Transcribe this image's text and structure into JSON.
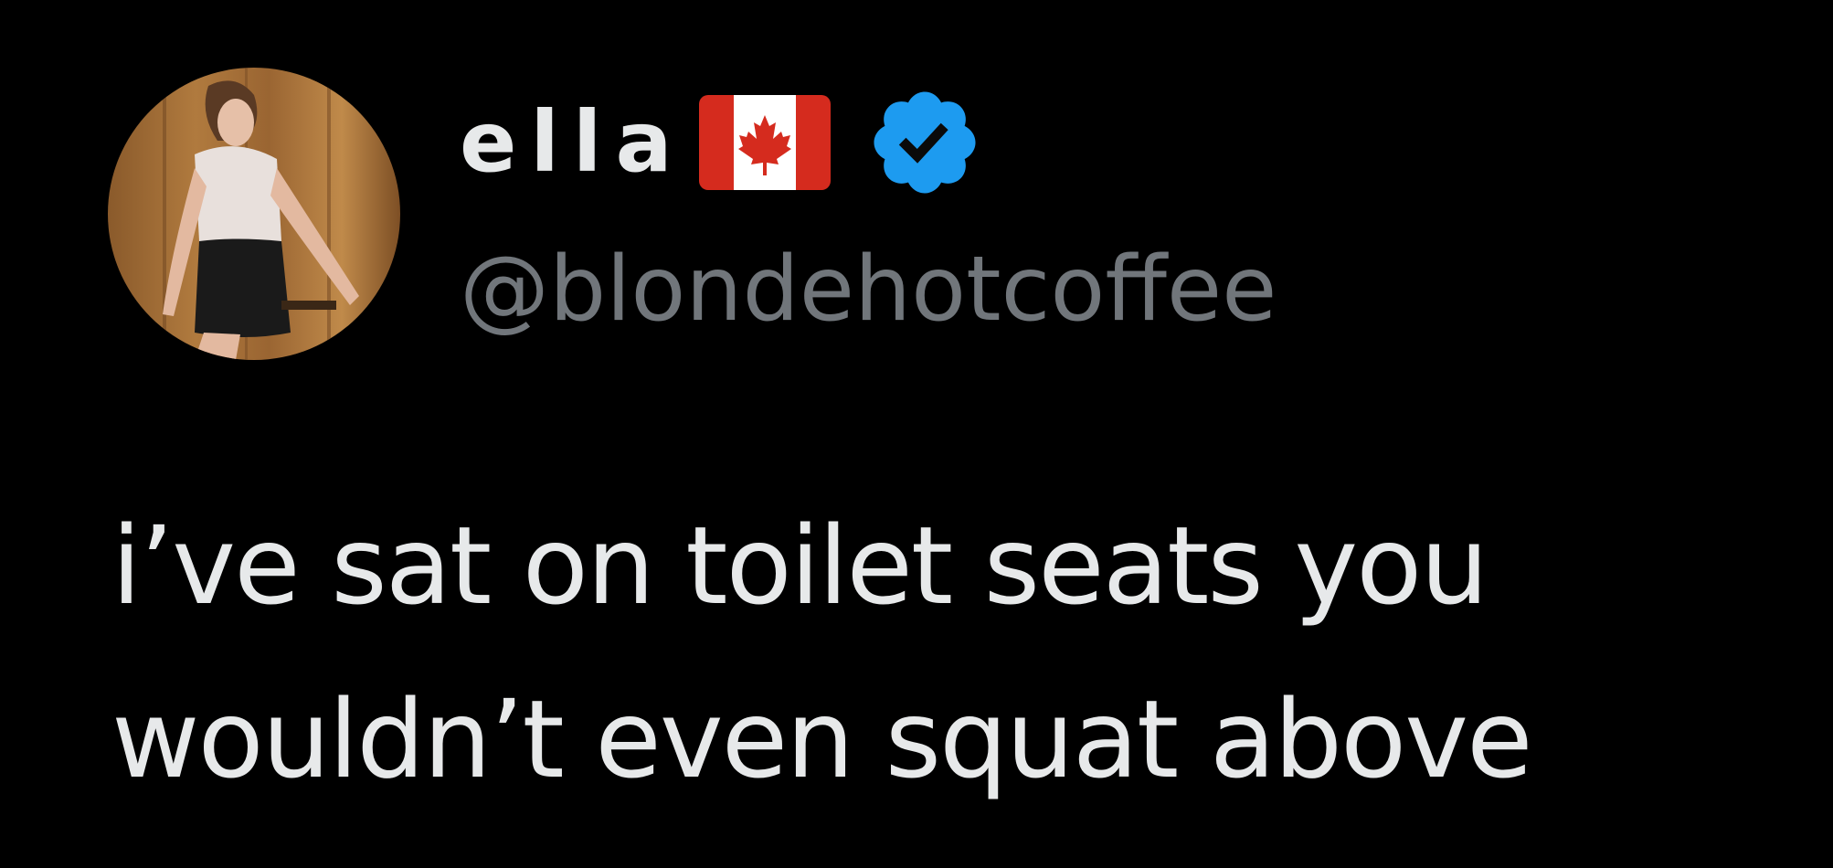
{
  "tweet": {
    "author": {
      "display_name": "ella",
      "flag": "canada-flag-icon",
      "verified": true,
      "handle": "@blondehotcoffee"
    },
    "text_lines": [
      "i’ve sat on toilet seats you",
      "wouldn’t even squat above"
    ]
  },
  "colors": {
    "background": "#000000",
    "text_primary": "#e7e9ea",
    "text_secondary": "#71767b",
    "verified_blue": "#1d9bf0",
    "flag_red": "#d52b1e"
  }
}
